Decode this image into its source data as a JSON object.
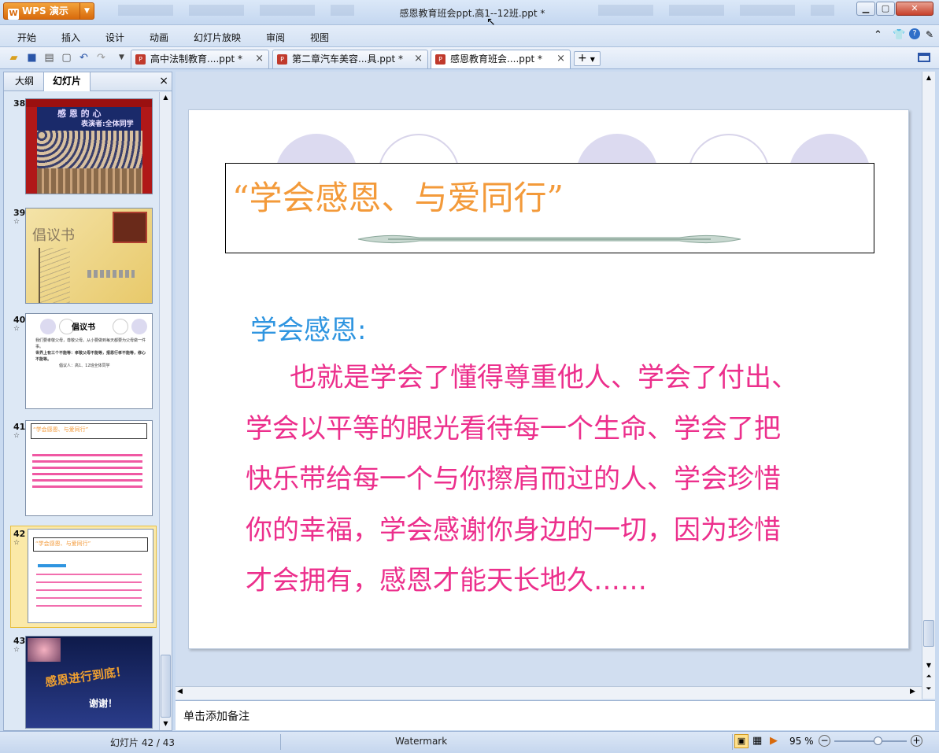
{
  "app": {
    "logo_label": "WPS 演示",
    "window_title": "感恩教育班会ppt.高1--12班.ppt *"
  },
  "window_controls": {
    "minimize": "▁",
    "maximize": "▢",
    "close": "✕"
  },
  "menu": {
    "items": [
      "开始",
      "插入",
      "设计",
      "动画",
      "幻灯片放映",
      "审阅",
      "视图"
    ]
  },
  "toolbar_icons": [
    "open-folder-icon",
    "save-icon",
    "print-icon",
    "print-preview-icon",
    "undo-icon",
    "redo-icon",
    "dropdown-icon"
  ],
  "doc_tabs": [
    {
      "label": "高中法制教育....ppt *",
      "active": false
    },
    {
      "label": "第二章汽车美容...具.ppt *",
      "active": false
    },
    {
      "label": "感恩教育班会....ppt *",
      "active": true
    }
  ],
  "new_tab_label": "+",
  "left_pane": {
    "tabs": [
      "大纲",
      "幻灯片"
    ],
    "close": "×",
    "slides": [
      {
        "num": "38",
        "title": "感 恩 的 心",
        "subtitle": "表演者:全体同学"
      },
      {
        "num": "39",
        "star": "☆",
        "title": "倡议书",
        "subtitle": ""
      },
      {
        "num": "40",
        "star": "☆",
        "title": "倡议书",
        "lines": [
          "我们要孝敬父母，尊敬父母。从小要做到每天都要为父母做一件事。",
          "世界上有三个不能等：孝敬父母不能等，报恩行孝不能等，修心不能等。",
          "倡议人：高1、12班全体同学"
        ]
      },
      {
        "num": "41",
        "star": "☆",
        "title": "“学会感恩、与爱同行”"
      },
      {
        "num": "42",
        "star": "☆",
        "title": "“学会感恩、与爱同行”",
        "selected": true
      },
      {
        "num": "43",
        "star": "☆",
        "title": "感恩进行到底！",
        "subtitle": "谢谢！"
      }
    ]
  },
  "slide": {
    "title": "“学会感恩、与爱同行”",
    "heading": "学会感恩:",
    "body_lines": [
      "也就是学会了懂得尊重他人、学会了付出、",
      "学会以平等的眼光看待每一个生命、学会了把",
      "快乐带给每一个与你擦肩而过的人、学会珍惜",
      "你的幸福，学会感谢你身边的一切，因为珍惜",
      "才会拥有，感恩才能天长地久……"
    ]
  },
  "notes_placeholder": "单击添加备注",
  "status": {
    "slide_counter": "幻灯片 42 / 43",
    "template": "Watermark",
    "zoom": "95 %",
    "zoom_level_fraction": 0.6
  },
  "colors": {
    "title_orange": "#f39a3a",
    "heading_blue": "#2f95e0",
    "body_pink": "#ec2f8c"
  }
}
